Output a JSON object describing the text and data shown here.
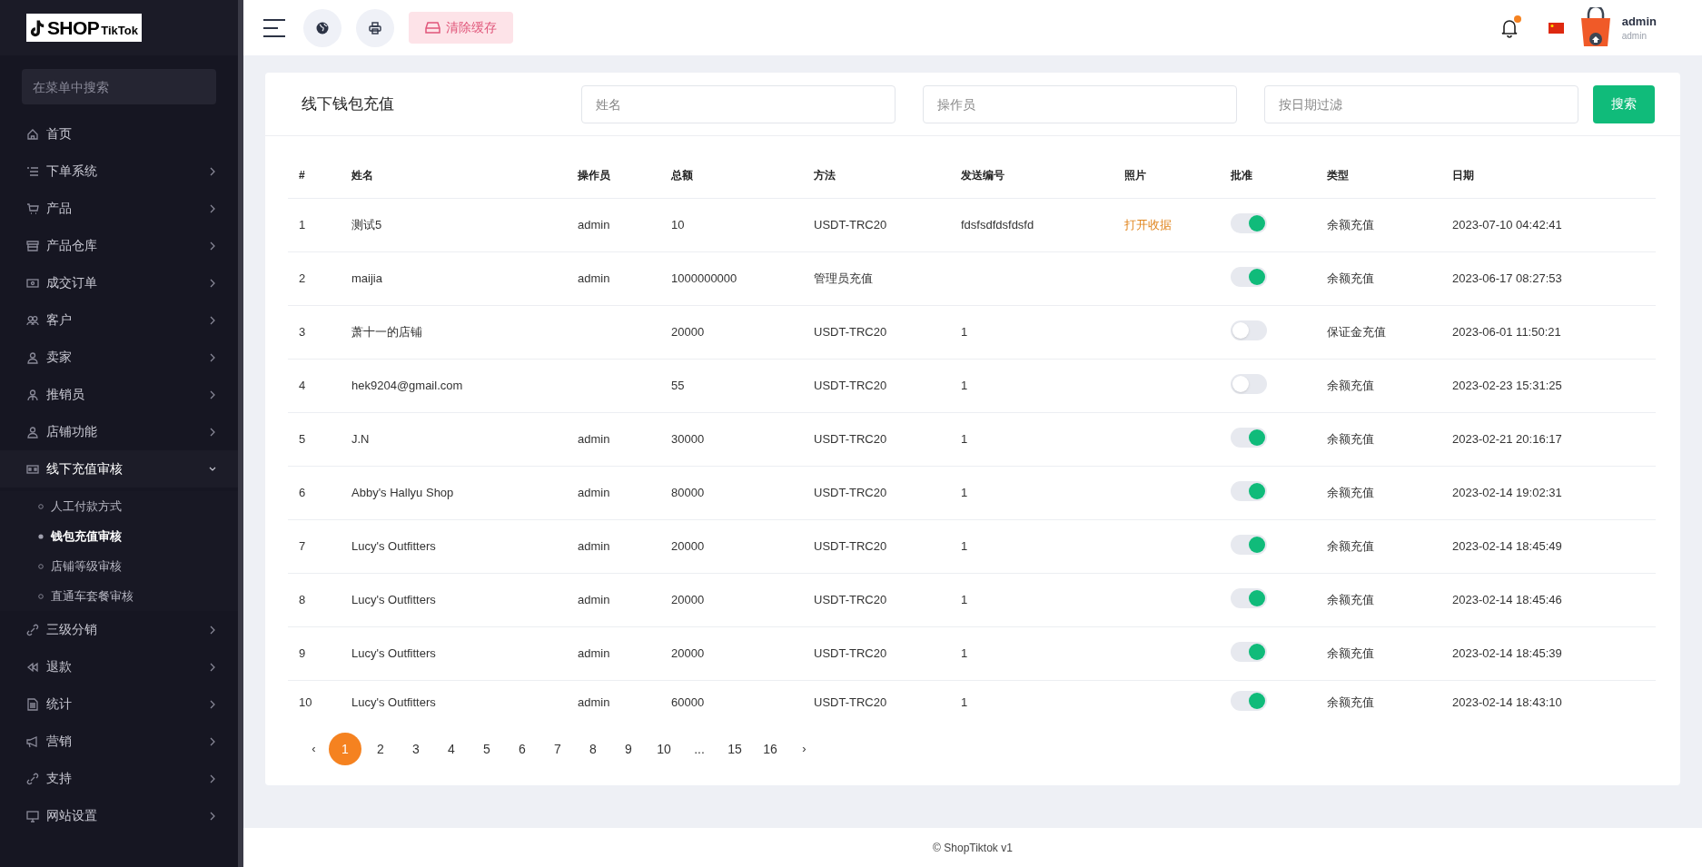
{
  "logo": {
    "text": "SHOP",
    "sub": "TikTok"
  },
  "sidebar": {
    "search": {
      "placeholder": "在菜单中搜索"
    },
    "items": [
      {
        "label": "首页",
        "has_arrow": false,
        "expanded": false
      },
      {
        "label": "下单系统",
        "has_arrow": true,
        "expanded": false
      },
      {
        "label": "产品",
        "has_arrow": true,
        "expanded": false
      },
      {
        "label": "产品仓库",
        "has_arrow": true,
        "expanded": false
      },
      {
        "label": "成交订单",
        "has_arrow": true,
        "expanded": false
      },
      {
        "label": "客户",
        "has_arrow": true,
        "expanded": false
      },
      {
        "label": "卖家",
        "has_arrow": true,
        "expanded": false
      },
      {
        "label": "推销员",
        "has_arrow": true,
        "expanded": false
      },
      {
        "label": "店铺功能",
        "has_arrow": true,
        "expanded": false
      },
      {
        "label": "线下充值审核",
        "has_arrow": true,
        "expanded": true,
        "children": [
          {
            "label": "人工付款方式",
            "selected": false
          },
          {
            "label": "钱包充值审核",
            "selected": true
          },
          {
            "label": "店铺等级审核",
            "selected": false
          },
          {
            "label": "直通车套餐审核",
            "selected": false
          }
        ]
      },
      {
        "label": "三级分销",
        "has_arrow": true,
        "expanded": false
      },
      {
        "label": "退款",
        "has_arrow": true,
        "expanded": false
      },
      {
        "label": "统计",
        "has_arrow": true,
        "expanded": false
      },
      {
        "label": "营销",
        "has_arrow": true,
        "expanded": false
      },
      {
        "label": "支持",
        "has_arrow": true,
        "expanded": false
      },
      {
        "label": "网站设置",
        "has_arrow": true,
        "expanded": false
      }
    ]
  },
  "topbar": {
    "clear_cache": "清除缓存",
    "notification_dot": true,
    "user": {
      "name": "admin",
      "role": "admin"
    }
  },
  "page": {
    "title": "线下钱包充值",
    "filters": [
      {
        "placeholder": "姓名"
      },
      {
        "placeholder": "操作员"
      },
      {
        "placeholder": "按日期过滤"
      }
    ],
    "search_button": "搜索"
  },
  "table": {
    "columns": [
      "#",
      "姓名",
      "操作员",
      "总额",
      "方法",
      "发送编号",
      "照片",
      "批准",
      "类型",
      "日期"
    ],
    "rows": [
      {
        "index": "1",
        "name": "测试5",
        "operator": "admin",
        "amount": "10",
        "method": "USDT-TRC20",
        "send_no": "fdsfsdfdsfdsfd",
        "photo": "打开收据",
        "approved": true,
        "type": "余额充值",
        "date": "2023-07-10 04:42:41"
      },
      {
        "index": "2",
        "name": "maijia",
        "operator": "admin",
        "amount": "1000000000",
        "method": "管理员充值",
        "send_no": "",
        "photo": "",
        "approved": true,
        "type": "余额充值",
        "date": "2023-06-17 08:27:53"
      },
      {
        "index": "3",
        "name": "萧十一的店铺",
        "operator": "",
        "amount": "20000",
        "method": "USDT-TRC20",
        "send_no": "1",
        "photo": "",
        "approved": false,
        "type": "保证金充值",
        "date": "2023-06-01 11:50:21"
      },
      {
        "index": "4",
        "name": "hek9204@gmail.com",
        "operator": "",
        "amount": "55",
        "method": "USDT-TRC20",
        "send_no": "1",
        "photo": "",
        "approved": false,
        "type": "余额充值",
        "date": "2023-02-23 15:31:25"
      },
      {
        "index": "5",
        "name": "J.N",
        "operator": "admin",
        "amount": "30000",
        "method": "USDT-TRC20",
        "send_no": "1",
        "photo": "",
        "approved": true,
        "type": "余额充值",
        "date": "2023-02-21 20:16:17"
      },
      {
        "index": "6",
        "name": "Abby's Hallyu Shop",
        "operator": "admin",
        "amount": "80000",
        "method": "USDT-TRC20",
        "send_no": "1",
        "photo": "",
        "approved": true,
        "type": "余额充值",
        "date": "2023-02-14 19:02:31"
      },
      {
        "index": "7",
        "name": "Lucy's Outfitters",
        "operator": "admin",
        "amount": "20000",
        "method": "USDT-TRC20",
        "send_no": "1",
        "photo": "",
        "approved": true,
        "type": "余额充值",
        "date": "2023-02-14 18:45:49"
      },
      {
        "index": "8",
        "name": "Lucy's Outfitters",
        "operator": "admin",
        "amount": "20000",
        "method": "USDT-TRC20",
        "send_no": "1",
        "photo": "",
        "approved": true,
        "type": "余额充值",
        "date": "2023-02-14 18:45:46"
      },
      {
        "index": "9",
        "name": "Lucy's Outfitters",
        "operator": "admin",
        "amount": "20000",
        "method": "USDT-TRC20",
        "send_no": "1",
        "photo": "",
        "approved": true,
        "type": "余额充值",
        "date": "2023-02-14 18:45:39"
      },
      {
        "index": "10",
        "name": "Lucy's Outfitters",
        "operator": "admin",
        "amount": "60000",
        "method": "USDT-TRC20",
        "send_no": "1",
        "photo": "",
        "approved": true,
        "type": "余额充值",
        "date": "2023-02-14 18:43:10"
      }
    ]
  },
  "pagination": {
    "prev": "‹",
    "next": "›",
    "pages": [
      {
        "label": "1",
        "selected": true
      },
      {
        "label": "2",
        "selected": false
      },
      {
        "label": "3",
        "selected": false
      },
      {
        "label": "4",
        "selected": false
      },
      {
        "label": "5",
        "selected": false
      },
      {
        "label": "6",
        "selected": false
      },
      {
        "label": "7",
        "selected": false
      },
      {
        "label": "8",
        "selected": false
      },
      {
        "label": "9",
        "selected": false
      },
      {
        "label": "10",
        "selected": false
      },
      {
        "label": "...",
        "selected": false
      },
      {
        "label": "15",
        "selected": false
      },
      {
        "label": "16",
        "selected": false
      }
    ]
  },
  "footer": "© ShopTiktok v1"
}
